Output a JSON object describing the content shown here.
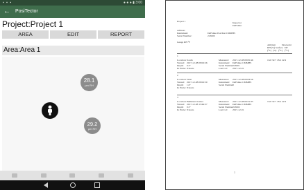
{
  "tablet": {
    "status": {
      "left": "▪ ▪ ▪",
      "right": "● ● ● ▮ 3:00"
    },
    "app_title": "PosiTector",
    "project_title": "Project:Project 1",
    "tabs": [
      {
        "label": "AREA"
      },
      {
        "label": "EDIT"
      },
      {
        "label": "REPORT"
      }
    ],
    "area_title": "Area:Area 1",
    "markers": [
      {
        "value": "28.1",
        "sub": "µm RH"
      },
      {
        "value": "29.2",
        "sub": "µm RH"
      }
    ]
  },
  "document": {
    "header": {
      "project": "Project 1",
      "inspector_label": "Inspector",
      "inspector_value": "DeFelsko",
      "address_label": "Address",
      "instrument_label": "Instrument:",
      "instrument_value": "DeFelsko PosiTest CMMHS",
      "serial_label": "Serial Number:",
      "serial_value": "213000",
      "gauge_label": "Gauge RH °F",
      "col_headers": [
        "Ambient",
        "RH (%)",
        "Surface",
        "DP",
        "Dewpoint"
      ],
      "col_units": [
        "(°C)",
        "(%)",
        "(°C)",
        "(°C)"
      ]
    },
    "sections": [
      {
        "id": "1",
        "location": "Location: South",
        "measured_label": "Measured:",
        "measured_value": "2017-12-08 08:05:46",
        "values": "16.8  32.7  18.2  22.9",
        "started_label": "Started:",
        "started_value": "2017-12-08 08:02:26",
        "instrument_label": "Instrument:",
        "instrument_value": "DeFelsko CMMHS",
        "depth_label": "Depth:",
        "depth_value": "0.5\"",
        "serial_label": "Serial Number:",
        "serial_value": "213001",
        "in_probe_label": "In Probe:",
        "in_probe_value": "8 hours",
        "last_cal_label": "Last Cal:",
        "last_cal_value": "2017-12-01"
      },
      {
        "id": "2",
        "location": "Location: West",
        "measured_label": "Measured:",
        "measured_value": "2017-12-08 09:03:56",
        "values": "",
        "started_label": "Started:",
        "started_value": "2017-12-08 08:02:50",
        "instrument_label": "Instrument:",
        "instrument_value": "DeFelsko CMMHS",
        "depth_label": "Depth:",
        "depth_value": "1.0\"",
        "serial_label": "Serial Number:",
        "serial_value": "0",
        "in_probe_label": "In Probe:",
        "in_probe_value": "8 hours",
        "last_cal_label": "",
        "last_cal_value": ""
      },
      {
        "id": "3",
        "location": "Location: Bulkhead Center",
        "measured_label": "Measured:",
        "measured_value": "2017-12-08 09:31:35",
        "values": "16.8  32.7  18.2  22.9",
        "started_label": "Started:",
        "started_value": "2017-12-08 13:49:37",
        "instrument_label": "Instrument:",
        "instrument_value": "DeFelsko CMMHS",
        "depth_label": "Depth:",
        "depth_value": "0.5\"",
        "serial_label": "Serial Number:",
        "serial_value": "213002",
        "in_probe_label": "In Probe:",
        "in_probe_value": "8 hours",
        "last_cal_label": "Last Cal:",
        "last_cal_value": "2017-12-01"
      }
    ],
    "page_number": "1"
  },
  "colors": {
    "appbar": "#3f6d4c",
    "statusbar": "#2d4a35",
    "marker_grey": "#8c8c8c",
    "marker_black": "#111111"
  }
}
